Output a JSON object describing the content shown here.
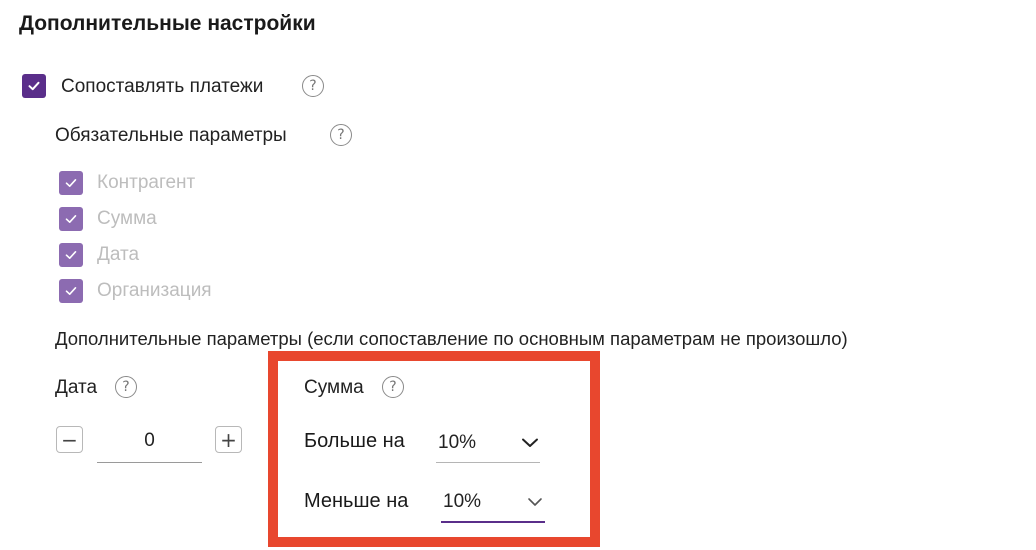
{
  "header": {
    "title": "Дополнительные настройки"
  },
  "match_payments": {
    "label": "Сопоставлять платежи",
    "checked": true
  },
  "required_params": {
    "title": "Обязательные параметры",
    "items": [
      {
        "label": "Контрагент",
        "checked": true,
        "disabled": true
      },
      {
        "label": "Сумма",
        "checked": true,
        "disabled": true
      },
      {
        "label": "Дата",
        "checked": true,
        "disabled": true
      },
      {
        "label": "Организация",
        "checked": true,
        "disabled": true
      }
    ]
  },
  "additional_params": {
    "title": "Дополнительные параметры (если сопоставление по основным параметрам не произошло)"
  },
  "date_param": {
    "label": "Дата",
    "value": "0",
    "minus": "−",
    "plus": "+"
  },
  "sum_param": {
    "label": "Сумма",
    "more_label": "Больше на",
    "more_value": "10%",
    "less_label": "Меньше на",
    "less_value": "10%"
  },
  "help_glyph": "?",
  "colors": {
    "checkbox": "#5a2e8a",
    "checkbox_disabled": "#8c6bb1",
    "highlight": "#e8472e",
    "active_underline": "#5a2e8a"
  }
}
